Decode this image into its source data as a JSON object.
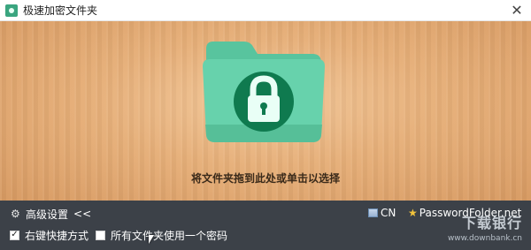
{
  "window": {
    "title": "极速加密文件夹"
  },
  "titlebar": {
    "close_glyph": "✕"
  },
  "drop_area": {
    "hint": "将文件夹拖到此处或单击以选择"
  },
  "bottom": {
    "advanced_label": "高级设置",
    "advanced_toggle": "<<",
    "language": "CN",
    "website": "PasswordFolder.net",
    "options": [
      {
        "label": "右键快捷方式",
        "checked": true
      },
      {
        "label": "所有文件夹使用一个密码",
        "checked": false
      }
    ]
  },
  "watermark": {
    "title": "下载银行",
    "url": "www.downbank.cn"
  },
  "colors": {
    "folder": "#5fcaa2",
    "folder_dark": "#3aa57f",
    "lock_circle": "#0f7a4f",
    "bottom_bg": "#3c4148"
  },
  "icons": {
    "app": "app-icon",
    "close": "close-icon",
    "folder": "lock-folder-icon",
    "gear": "gear-icon",
    "flag": "flag-icon",
    "star": "star-icon"
  }
}
